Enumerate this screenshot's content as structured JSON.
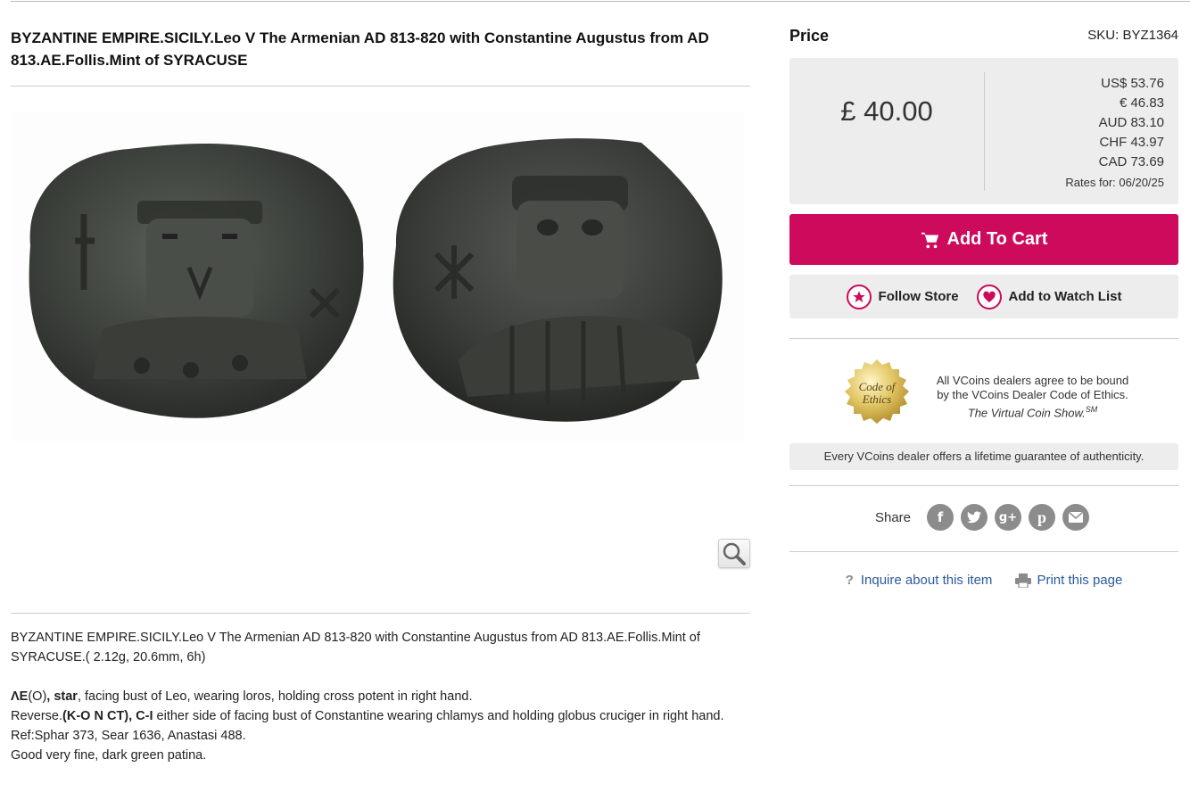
{
  "product": {
    "title": "BYZANTINE EMPIRE.SICILY.Leo V The Armenian AD 813-820 with Constantine Augustus from AD 813.AE.Follis.Mint of SYRACUSE",
    "description": {
      "line1": "BYZANTINE EMPIRE.SICILY.Leo V The Armenian AD 813-820 with Constantine Augustus from AD 813.AE.Follis.Mint of SYRACUSE.( 2.12g, 20.6mm, 6h)",
      "obverse_legend": "ΛΕ",
      "obverse_paren": "(O)",
      "obverse_star": ", star",
      "obverse_rest": ", facing bust of Leo, wearing loros, holding cross potent in right hand.",
      "reverse_prefix": "Reverse.",
      "reverse_legend": "(K-O N CT), C-I",
      "reverse_rest": " either side of facing bust of Constantine wearing chlamys and holding globus cruciger in right hand.",
      "ref": "Ref:Sphar 373, Sear 1636, Anastasi 488.",
      "grade": "Good very fine, dark green patina."
    }
  },
  "pricing": {
    "label": "Price",
    "sku": "SKU: BYZ1364",
    "main": "£ 40.00",
    "rates": [
      "US$ 53.76",
      "€ 46.83",
      "AUD 83.10",
      "CHF 43.97",
      "CAD 73.69"
    ],
    "rates_date": "Rates for: 06/20/25"
  },
  "actions": {
    "add_to_cart": "Add To Cart",
    "follow_store": "Follow Store",
    "watch_list": "Add to Watch List"
  },
  "ethics": {
    "seal_line1": "Code of",
    "seal_line2": "Ethics",
    "line1": "All VCoins dealers agree to be bound",
    "line2": "by the VCoins Dealer Code of Ethics.",
    "line3": "The Virtual Coin Show.",
    "line3_sup": "SM",
    "guarantee": "Every VCoins dealer offers a lifetime guarantee of authenticity."
  },
  "share": {
    "label": "Share",
    "icons": [
      "facebook-icon",
      "twitter-icon",
      "google-plus-icon",
      "pinterest-icon",
      "email-icon"
    ]
  },
  "links": {
    "inquire": "Inquire about this item",
    "print": "Print this page"
  },
  "colors": {
    "accent": "#cd0a5c",
    "link": "#2b5b9e",
    "panel": "#ededed"
  }
}
